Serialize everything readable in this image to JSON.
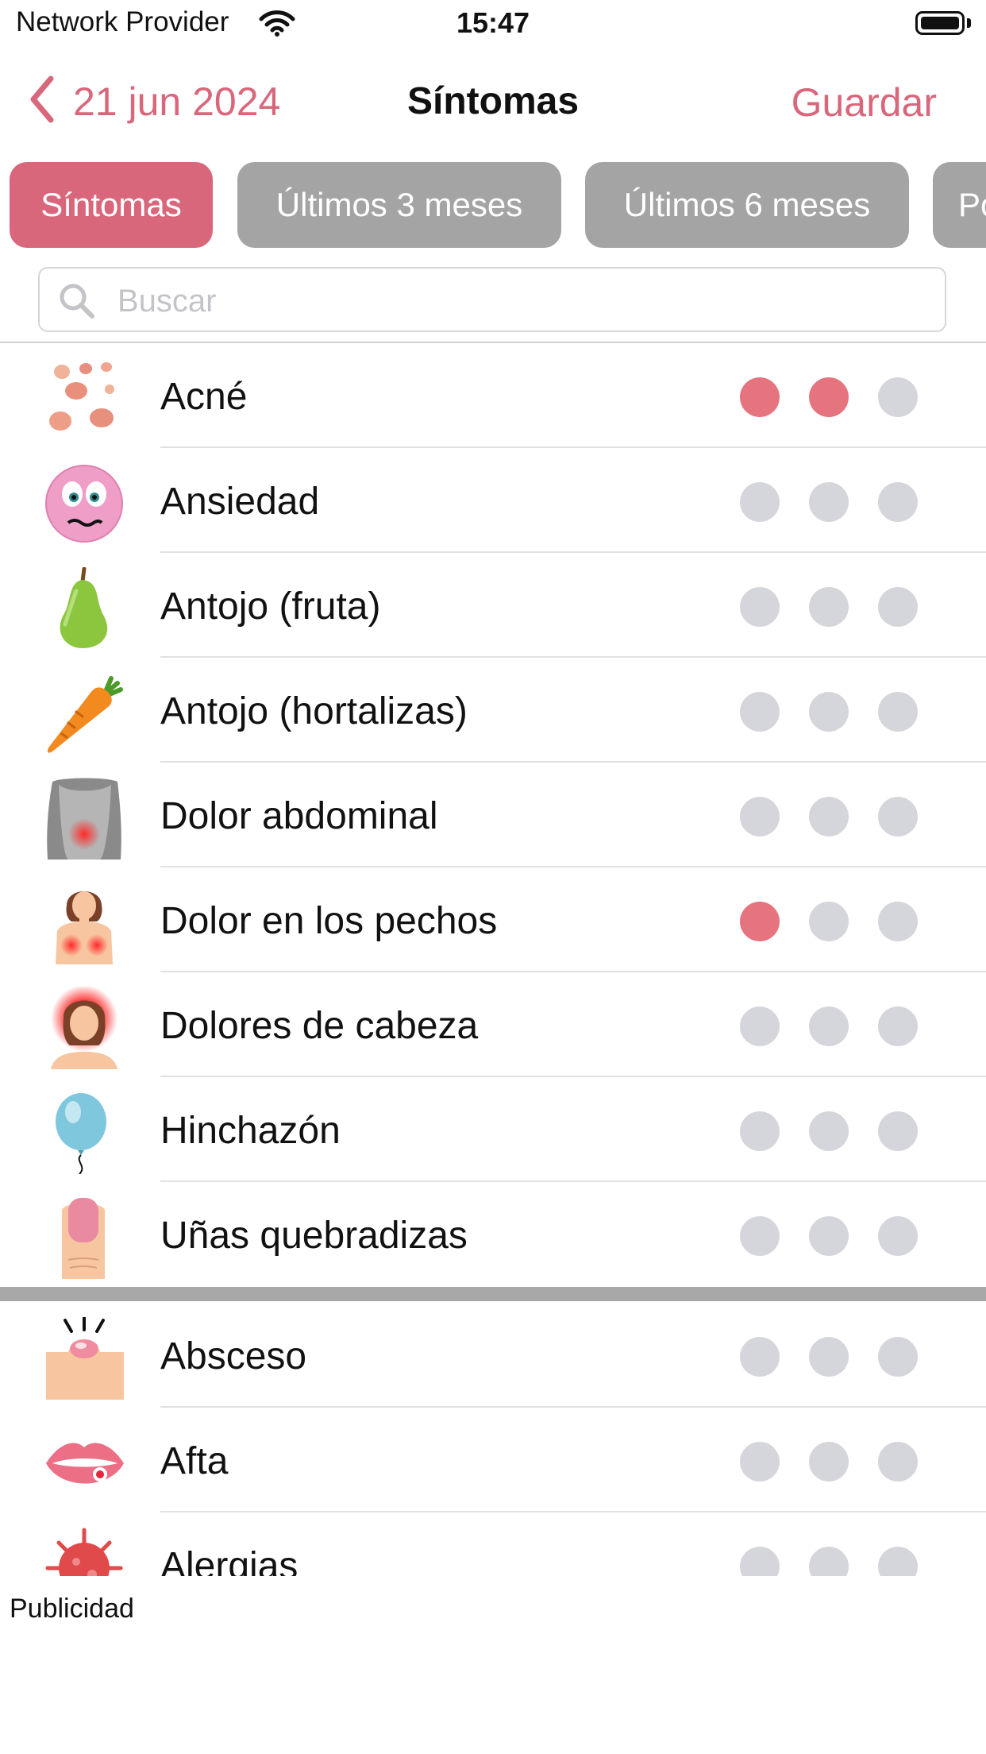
{
  "status_bar": {
    "carrier": "Network Provider",
    "time": "15:47"
  },
  "nav": {
    "back_date": "21 jun 2024",
    "title": "Síntomas",
    "save_label": "Guardar"
  },
  "tabs": [
    "Síntomas",
    "Últimos 3 meses",
    "Últimos 6 meses",
    "Po"
  ],
  "search": {
    "placeholder": "Buscar"
  },
  "colors": {
    "accent": "#d9677c",
    "dot_on": "#e6747f",
    "dot_off": "#d5d5dc",
    "tab_inactive": "#a4a4a4"
  },
  "favorites": [
    {
      "label": "Acné",
      "icon": "acne-icon",
      "level": 2
    },
    {
      "label": "Ansiedad",
      "icon": "anxious-face-icon",
      "level": 0
    },
    {
      "label": "Antojo (fruta)",
      "icon": "pear-icon",
      "level": 0
    },
    {
      "label": "Antojo (hortalizas)",
      "icon": "carrot-icon",
      "level": 0
    },
    {
      "label": "Dolor abdominal",
      "icon": "abdomen-icon",
      "level": 0
    },
    {
      "label": "Dolor en los pechos",
      "icon": "breast-pain-icon",
      "level": 1
    },
    {
      "label": "Dolores de cabeza",
      "icon": "headache-icon",
      "level": 0
    },
    {
      "label": "Hinchazón",
      "icon": "balloon-icon",
      "level": 0
    },
    {
      "label": "Uñas quebradizas",
      "icon": "nail-icon",
      "level": 0
    }
  ],
  "others": [
    {
      "label": "Absceso",
      "icon": "abscess-icon",
      "level": 0
    },
    {
      "label": "Afta",
      "icon": "lips-icon",
      "level": 0
    },
    {
      "label": "Alergias",
      "icon": "virus-icon",
      "level": 0
    }
  ],
  "ad_label": "Publicidad"
}
